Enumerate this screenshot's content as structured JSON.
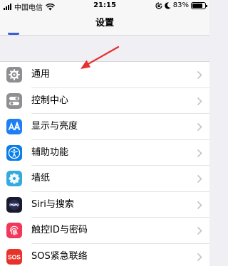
{
  "status_bar": {
    "carrier": "中国电信",
    "time": "21:15",
    "battery_text": "83%",
    "battery_level": 0.83,
    "icons": [
      "signal-icon",
      "wifi-icon",
      "lock-rotation-icon",
      "moon-icon",
      "battery-icon"
    ]
  },
  "nav": {
    "title": "设置"
  },
  "settings": [
    {
      "label": "通用",
      "icon": "gear-icon",
      "color": "#8e8e93"
    },
    {
      "label": "控制中心",
      "icon": "toggles-icon",
      "color": "#8e8e93"
    },
    {
      "label": "显示与亮度",
      "icon": "text-size-icon",
      "color": "#1e7ff5"
    },
    {
      "label": "辅助功能",
      "icon": "accessibility-icon",
      "color": "#0a7ee8"
    },
    {
      "label": "墙纸",
      "icon": "flower-icon",
      "color": "#35aadc"
    },
    {
      "label": "Siri与搜索",
      "icon": "siri-icon",
      "color": "#1a1a2e"
    },
    {
      "label": "触控ID与密码",
      "icon": "fingerprint-icon",
      "color": "#f2385a"
    },
    {
      "label": "SOS紧急联络",
      "icon": "sos-icon",
      "color": "#e8332b"
    }
  ],
  "annotation": {
    "color": "#e53030",
    "icon": "pointer-arrow-icon"
  }
}
